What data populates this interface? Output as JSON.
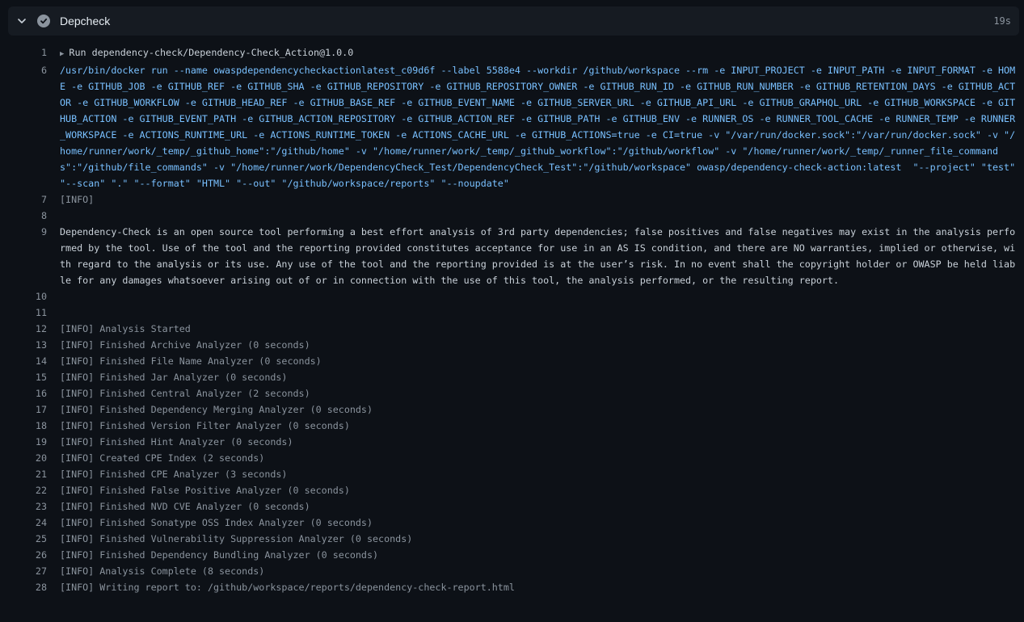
{
  "step": {
    "title": "Depcheck",
    "duration": "19s",
    "status": "success"
  },
  "lines": [
    {
      "n": "1",
      "text": "Run dependency-check/Dependency-Check_Action@1.0.0",
      "kind": "group"
    },
    {
      "n": "6",
      "text": "/usr/bin/docker run --name owaspdependencycheckactionlatest_c09d6f --label 5588e4 --workdir /github/workspace --rm -e INPUT_PROJECT -e INPUT_PATH -e INPUT_FORMAT -e HOME -e GITHUB_JOB -e GITHUB_REF -e GITHUB_SHA -e GITHUB_REPOSITORY -e GITHUB_REPOSITORY_OWNER -e GITHUB_RUN_ID -e GITHUB_RUN_NUMBER -e GITHUB_RETENTION_DAYS -e GITHUB_ACTOR -e GITHUB_WORKFLOW -e GITHUB_HEAD_REF -e GITHUB_BASE_REF -e GITHUB_EVENT_NAME -e GITHUB_SERVER_URL -e GITHUB_API_URL -e GITHUB_GRAPHQL_URL -e GITHUB_WORKSPACE -e GITHUB_ACTION -e GITHUB_EVENT_PATH -e GITHUB_ACTION_REPOSITORY -e GITHUB_ACTION_REF -e GITHUB_PATH -e GITHUB_ENV -e RUNNER_OS -e RUNNER_TOOL_CACHE -e RUNNER_TEMP -e RUNNER_WORKSPACE -e ACTIONS_RUNTIME_URL -e ACTIONS_RUNTIME_TOKEN -e ACTIONS_CACHE_URL -e GITHUB_ACTIONS=true -e CI=true -v \"/var/run/docker.sock\":\"/var/run/docker.sock\" -v \"/home/runner/work/_temp/_github_home\":\"/github/home\" -v \"/home/runner/work/_temp/_github_workflow\":\"/github/workflow\" -v \"/home/runner/work/_temp/_runner_file_commands\":\"/github/file_commands\" -v \"/home/runner/work/DependencyCheck_Test/DependencyCheck_Test\":\"/github/workspace\" owasp/dependency-check-action:latest  \"--project\" \"test\" \"--scan\" \".\" \"--format\" \"HTML\" \"--out\" \"/github/workspace/reports\" \"--noupdate\"",
      "kind": "cmd"
    },
    {
      "n": "7",
      "text": "[INFO]",
      "kind": "info"
    },
    {
      "n": "8",
      "text": "",
      "kind": "plain"
    },
    {
      "n": "9",
      "text": "Dependency-Check is an open source tool performing a best effort analysis of 3rd party dependencies; false positives and false negatives may exist in the analysis performed by the tool. Use of the tool and the reporting provided constitutes acceptance for use in an AS IS condition, and there are NO warranties, implied or otherwise, with regard to the analysis or its use. Any use of the tool and the reporting provided is at the user’s risk. In no event shall the copyright holder or OWASP be held liable for any damages whatsoever arising out of or in connection with the use of this tool, the analysis performed, or the resulting report.",
      "kind": "plain"
    },
    {
      "n": "10",
      "text": "",
      "kind": "plain"
    },
    {
      "n": "11",
      "text": "",
      "kind": "plain"
    },
    {
      "n": "12",
      "text": "[INFO] Analysis Started",
      "kind": "info"
    },
    {
      "n": "13",
      "text": "[INFO] Finished Archive Analyzer (0 seconds)",
      "kind": "info"
    },
    {
      "n": "14",
      "text": "[INFO] Finished File Name Analyzer (0 seconds)",
      "kind": "info"
    },
    {
      "n": "15",
      "text": "[INFO] Finished Jar Analyzer (0 seconds)",
      "kind": "info"
    },
    {
      "n": "16",
      "text": "[INFO] Finished Central Analyzer (2 seconds)",
      "kind": "info"
    },
    {
      "n": "17",
      "text": "[INFO] Finished Dependency Merging Analyzer (0 seconds)",
      "kind": "info"
    },
    {
      "n": "18",
      "text": "[INFO] Finished Version Filter Analyzer (0 seconds)",
      "kind": "info"
    },
    {
      "n": "19",
      "text": "[INFO] Finished Hint Analyzer (0 seconds)",
      "kind": "info"
    },
    {
      "n": "20",
      "text": "[INFO] Created CPE Index (2 seconds)",
      "kind": "info"
    },
    {
      "n": "21",
      "text": "[INFO] Finished CPE Analyzer (3 seconds)",
      "kind": "info"
    },
    {
      "n": "22",
      "text": "[INFO] Finished False Positive Analyzer (0 seconds)",
      "kind": "info"
    },
    {
      "n": "23",
      "text": "[INFO] Finished NVD CVE Analyzer (0 seconds)",
      "kind": "info"
    },
    {
      "n": "24",
      "text": "[INFO] Finished Sonatype OSS Index Analyzer (0 seconds)",
      "kind": "info"
    },
    {
      "n": "25",
      "text": "[INFO] Finished Vulnerability Suppression Analyzer (0 seconds)",
      "kind": "info"
    },
    {
      "n": "26",
      "text": "[INFO] Finished Dependency Bundling Analyzer (0 seconds)",
      "kind": "info"
    },
    {
      "n": "27",
      "text": "[INFO] Analysis Complete (8 seconds)",
      "kind": "info"
    },
    {
      "n": "28",
      "text": "[INFO] Writing report to: /github/workspace/reports/dependency-check-report.html",
      "kind": "info"
    }
  ],
  "icons": {
    "collapse": "chevron-down-icon",
    "status": "check-circle-icon",
    "group": "triangle-right-icon"
  },
  "colors": {
    "background": "#0d1117",
    "header": "#161b22",
    "command": "#79c0ff",
    "muted": "#8b949e"
  }
}
